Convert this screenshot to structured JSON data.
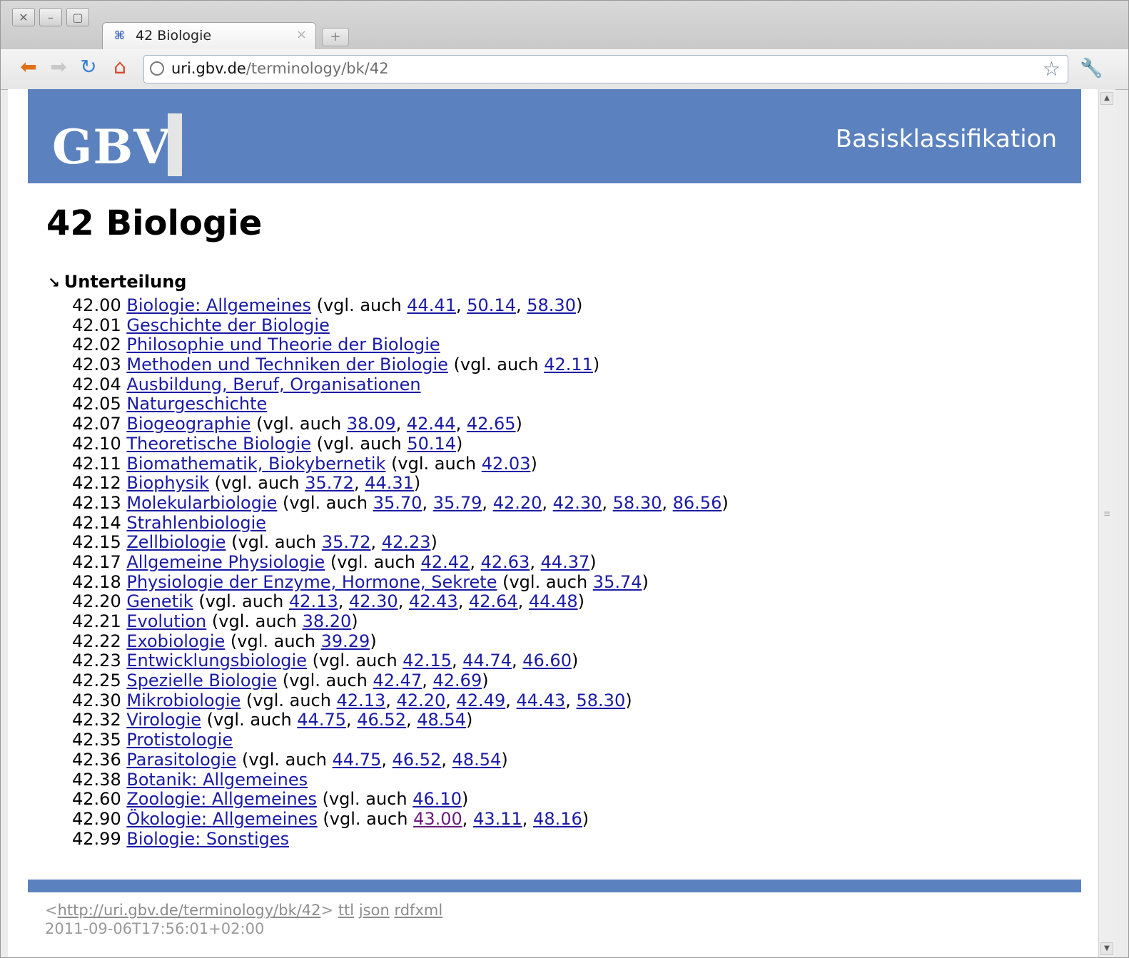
{
  "browser": {
    "window_buttons": [
      "✕",
      "–",
      "▢"
    ],
    "tab": {
      "title": "42 Biologie"
    },
    "url": {
      "host": "uri.gbv.de",
      "path": "/terminology/bk/42"
    }
  },
  "banner": {
    "logo": "GBV",
    "title": "Basisklassifikation"
  },
  "page": {
    "title": "42 Biologie",
    "section": "Unterteilung"
  },
  "labels": {
    "see_also_prefix": " (vgl. auch ",
    "see_also_suffix": ")",
    "separator": ", "
  },
  "items": [
    {
      "code": "42.00",
      "name": "Biologie: Allgemeines",
      "see": [
        "44.41",
        "50.14",
        "58.30"
      ]
    },
    {
      "code": "42.01",
      "name": "Geschichte der Biologie",
      "see": []
    },
    {
      "code": "42.02",
      "name": "Philosophie und Theorie der Biologie",
      "see": []
    },
    {
      "code": "42.03",
      "name": "Methoden und Techniken der Biologie",
      "see": [
        "42.11"
      ]
    },
    {
      "code": "42.04",
      "name": "Ausbildung, Beruf, Organisationen",
      "see": []
    },
    {
      "code": "42.05",
      "name": "Naturgeschichte",
      "see": []
    },
    {
      "code": "42.07",
      "name": "Biogeographie",
      "see": [
        "38.09",
        "42.44",
        "42.65"
      ]
    },
    {
      "code": "42.10",
      "name": "Theoretische Biologie",
      "see": [
        "50.14"
      ]
    },
    {
      "code": "42.11",
      "name": "Biomathematik, Biokybernetik",
      "see": [
        "42.03"
      ]
    },
    {
      "code": "42.12",
      "name": "Biophysik",
      "see": [
        "35.72",
        "44.31"
      ]
    },
    {
      "code": "42.13",
      "name": "Molekularbiologie",
      "see": [
        "35.70",
        "35.79",
        "42.20",
        "42.30",
        "58.30",
        "86.56"
      ]
    },
    {
      "code": "42.14",
      "name": "Strahlenbiologie",
      "see": []
    },
    {
      "code": "42.15",
      "name": "Zellbiologie",
      "see": [
        "35.72",
        "42.23"
      ]
    },
    {
      "code": "42.17",
      "name": "Allgemeine Physiologie",
      "see": [
        "42.42",
        "42.63",
        "44.37"
      ]
    },
    {
      "code": "42.18",
      "name": "Physiologie der Enzyme, Hormone, Sekrete",
      "see": [
        "35.74"
      ]
    },
    {
      "code": "42.20",
      "name": "Genetik",
      "see": [
        "42.13",
        "42.30",
        "42.43",
        "42.64",
        "44.48"
      ]
    },
    {
      "code": "42.21",
      "name": "Evolution",
      "see": [
        "38.20"
      ]
    },
    {
      "code": "42.22",
      "name": "Exobiologie",
      "see": [
        "39.29"
      ]
    },
    {
      "code": "42.23",
      "name": "Entwicklungsbiologie",
      "see": [
        "42.15",
        "44.74",
        "46.60"
      ]
    },
    {
      "code": "42.25",
      "name": "Spezielle Biologie",
      "see": [
        "42.47",
        "42.69"
      ]
    },
    {
      "code": "42.30",
      "name": "Mikrobiologie",
      "see": [
        "42.13",
        "42.20",
        "42.49",
        "44.43",
        "58.30"
      ]
    },
    {
      "code": "42.32",
      "name": "Virologie",
      "see": [
        "44.75",
        "46.52",
        "48.54"
      ]
    },
    {
      "code": "42.35",
      "name": "Protistologie",
      "see": []
    },
    {
      "code": "42.36",
      "name": "Parasitologie",
      "see": [
        "44.75",
        "46.52",
        "48.54"
      ]
    },
    {
      "code": "42.38",
      "name": "Botanik: Allgemeines",
      "see": []
    },
    {
      "code": "42.60",
      "name": "Zoologie: Allgemeines",
      "see": [
        "46.10"
      ]
    },
    {
      "code": "42.90",
      "name": "Ökologie: Allgemeines",
      "see": [
        "43.00",
        "43.11",
        "48.16"
      ],
      "visited": [
        "43.00"
      ]
    },
    {
      "code": "42.99",
      "name": "Biologie: Sonstiges",
      "see": []
    }
  ],
  "footer": {
    "uri_open": "<",
    "uri": "http://uri.gbv.de/terminology/bk/42",
    "uri_close": ">",
    "formats": [
      "ttl",
      "json",
      "rdfxml"
    ],
    "timestamp": "2011-09-06T17:56:01+02:00"
  },
  "colors": {
    "banner": "#5b82bf",
    "link": "#1a1aa6",
    "visited": "#6a1b7a"
  }
}
